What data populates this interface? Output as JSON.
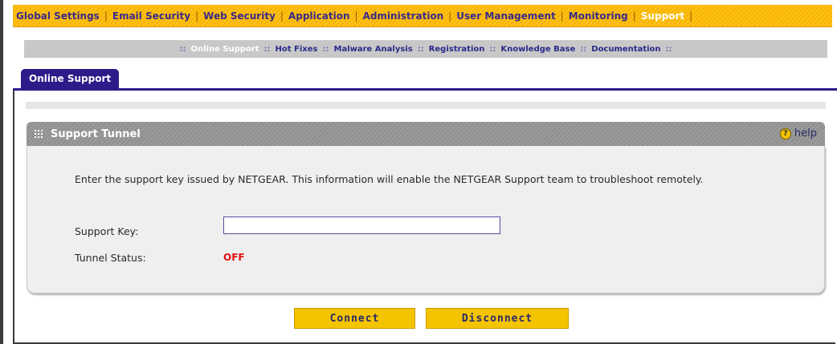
{
  "main_nav": {
    "items": [
      {
        "label": "Global Settings"
      },
      {
        "label": "Email Security"
      },
      {
        "label": "Web Security"
      },
      {
        "label": "Application"
      },
      {
        "label": "Administration"
      },
      {
        "label": "User Management"
      },
      {
        "label": "Monitoring"
      },
      {
        "label": "Support"
      }
    ],
    "separator": "|",
    "active": "Support"
  },
  "sub_nav": {
    "items": [
      {
        "label": "Online Support"
      },
      {
        "label": "Hot Fixes"
      },
      {
        "label": "Malware Analysis"
      },
      {
        "label": "Registration"
      },
      {
        "label": "Knowledge Base"
      },
      {
        "label": "Documentation"
      }
    ],
    "separator": "::",
    "active": "Online Support"
  },
  "tab": {
    "label": "Online Support"
  },
  "section": {
    "title": "Support Tunnel",
    "help_label": "help",
    "description": "Enter the support key issued by NETGEAR. This information will enable the NETGEAR Support team to troubleshoot remotely.",
    "support_key_label": "Support Key:",
    "support_key_value": "",
    "tunnel_status_label": "Tunnel Status:",
    "tunnel_status_value": "OFF"
  },
  "buttons": {
    "connect": "Connect",
    "disconnect": "Disconnect"
  },
  "colors": {
    "nav_yellow": "#f5b400",
    "tab_purple": "#2d1b8a",
    "status_red": "#e31010",
    "button_yellow": "#f5c400"
  }
}
